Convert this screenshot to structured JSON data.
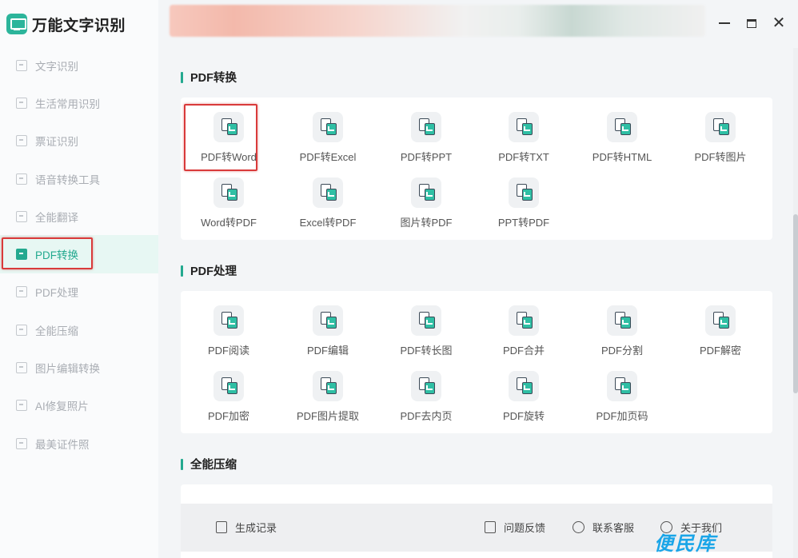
{
  "app": {
    "title": "万能文字识别"
  },
  "sidebar": {
    "items": [
      {
        "label": "文字识别",
        "icon": "scan-icon"
      },
      {
        "label": "生活常用识别",
        "icon": "scan-icon"
      },
      {
        "label": "票证识别",
        "icon": "scan-icon"
      },
      {
        "label": "语音转换工具",
        "icon": "audio-icon"
      },
      {
        "label": "全能翻译",
        "icon": "translate-icon"
      },
      {
        "label": "PDF转换",
        "icon": "pdf-convert-icon",
        "active": true
      },
      {
        "label": "PDF处理",
        "icon": "pdf-process-icon"
      },
      {
        "label": "全能压缩",
        "icon": "compress-icon"
      },
      {
        "label": "图片编辑转换",
        "icon": "image-edit-icon"
      },
      {
        "label": "AI修复照片",
        "icon": "ai-photo-icon"
      },
      {
        "label": "最美证件照",
        "icon": "id-photo-icon"
      }
    ]
  },
  "window": {
    "minimize": "—",
    "maximize": "□",
    "close": "✕"
  },
  "sections": {
    "convert": {
      "title": "PDF转换",
      "tools": [
        "PDF转Word",
        "PDF转Excel",
        "PDF转PPT",
        "PDF转TXT",
        "PDF转HTML",
        "PDF转图片",
        "Word转PDF",
        "Excel转PDF",
        "图片转PDF",
        "PPT转PDF"
      ]
    },
    "process": {
      "title": "PDF处理",
      "tools": [
        "PDF阅读",
        "PDF编辑",
        "PDF转长图",
        "PDF合并",
        "PDF分割",
        "PDF解密",
        "PDF加密",
        "PDF图片提取",
        "PDF去内页",
        "PDF旋转",
        "PDF加页码"
      ]
    },
    "compress": {
      "title": "全能压缩"
    }
  },
  "footer": {
    "records": "生成记录",
    "feedback": "问题反馈",
    "contact": "联系客服",
    "about": "关于我们"
  },
  "watermark": "便民库",
  "colors": {
    "accent": "#23a98f",
    "highlight_box": "#d93a3a"
  }
}
